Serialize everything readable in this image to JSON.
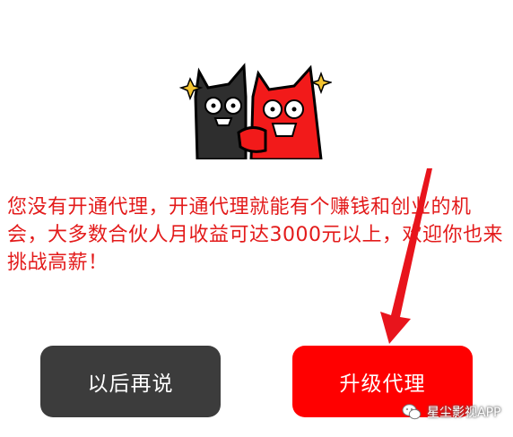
{
  "dialog": {
    "message": "您没有开通代理，开通代理就能有个赚钱和创业的机会，大多数合伙人月收益可达3000元以上，欢迎你也来挑战高薪！",
    "buttons": {
      "later_label": "以后再说",
      "upgrade_label": "升级代理"
    }
  },
  "watermark": {
    "text": "星尘影视APP"
  },
  "colors": {
    "message_text": "#e31b1b",
    "later_button": "#3c3c3c",
    "upgrade_button": "#ff0000",
    "arrow": "#e8141c"
  },
  "icons": [
    "cartoon-cats-illustration",
    "arrow-annotation",
    "wechat-icon"
  ]
}
